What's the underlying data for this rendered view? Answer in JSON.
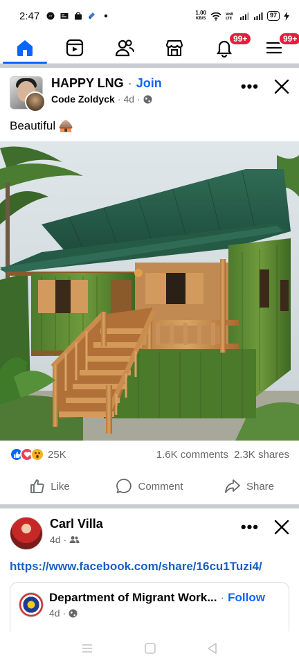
{
  "status_bar": {
    "time": "2:47",
    "net_speed_value": "1.00",
    "net_speed_unit": "KB/S",
    "battery": "97"
  },
  "nav": {
    "accent": "#0866ff",
    "tabs": [
      {
        "icon": "home-icon",
        "active": true
      },
      {
        "icon": "video-icon"
      },
      {
        "icon": "friends-icon"
      },
      {
        "icon": "marketplace-icon"
      },
      {
        "icon": "notifications-icon",
        "badge": "99+"
      },
      {
        "icon": "menu-icon",
        "badge": "99+"
      }
    ]
  },
  "post1": {
    "group_name": "HAPPY LNG",
    "join_label": "Join",
    "author": "Code Zoldyck",
    "time": "4d",
    "caption": "Beautiful 🛖",
    "reactions_count": "25K",
    "comments": "1.6K comments",
    "shares": "2.3K shares",
    "actions": {
      "like": "Like",
      "comment": "Comment",
      "share": "Share"
    }
  },
  "post2": {
    "author": "Carl Villa",
    "time": "4d",
    "link": "https://www.facebook.com/share/16cu1Tuzi4/",
    "shared": {
      "name": "Department of Migrant Work...",
      "follow_label": "Follow",
      "time": "4d"
    }
  }
}
